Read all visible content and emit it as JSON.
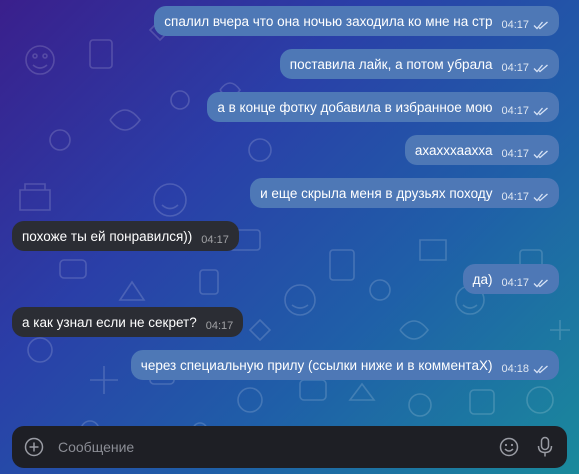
{
  "chat": {
    "messages": [
      {
        "dir": "out",
        "text": "спалил вчера что она ночью заходила ко мне на стр",
        "time": "04:17"
      },
      {
        "dir": "out",
        "text": "поставила лайк, а потом убрала",
        "time": "04:17"
      },
      {
        "dir": "out",
        "text": "а в конце фотку добавила в избранное мою",
        "time": "04:17"
      },
      {
        "dir": "out",
        "text": "ахахххаахха",
        "time": "04:17"
      },
      {
        "dir": "out",
        "text": "и еще скрыла меня в друзьях походу",
        "time": "04:17"
      },
      {
        "dir": "in",
        "text": "похоже ты ей понравился))",
        "time": "04:17"
      },
      {
        "dir": "out",
        "text": "да)",
        "time": "04:17"
      },
      {
        "dir": "in",
        "text": "а как узнал если не секрет?",
        "time": "04:17"
      },
      {
        "dir": "out",
        "text": "через специальную прилу (ссылки ниже и в комментаХ)",
        "time": "04:18"
      }
    ]
  },
  "composer": {
    "placeholder": "Сообщение",
    "attach_icon": "plus-circle-icon",
    "emoji_icon": "smiley-icon",
    "voice_icon": "microphone-icon"
  },
  "colors": {
    "outgoing_bubble": "#4e78b6",
    "incoming_bubble": "#2b2d34",
    "composer_bg": "#1e1f25"
  }
}
